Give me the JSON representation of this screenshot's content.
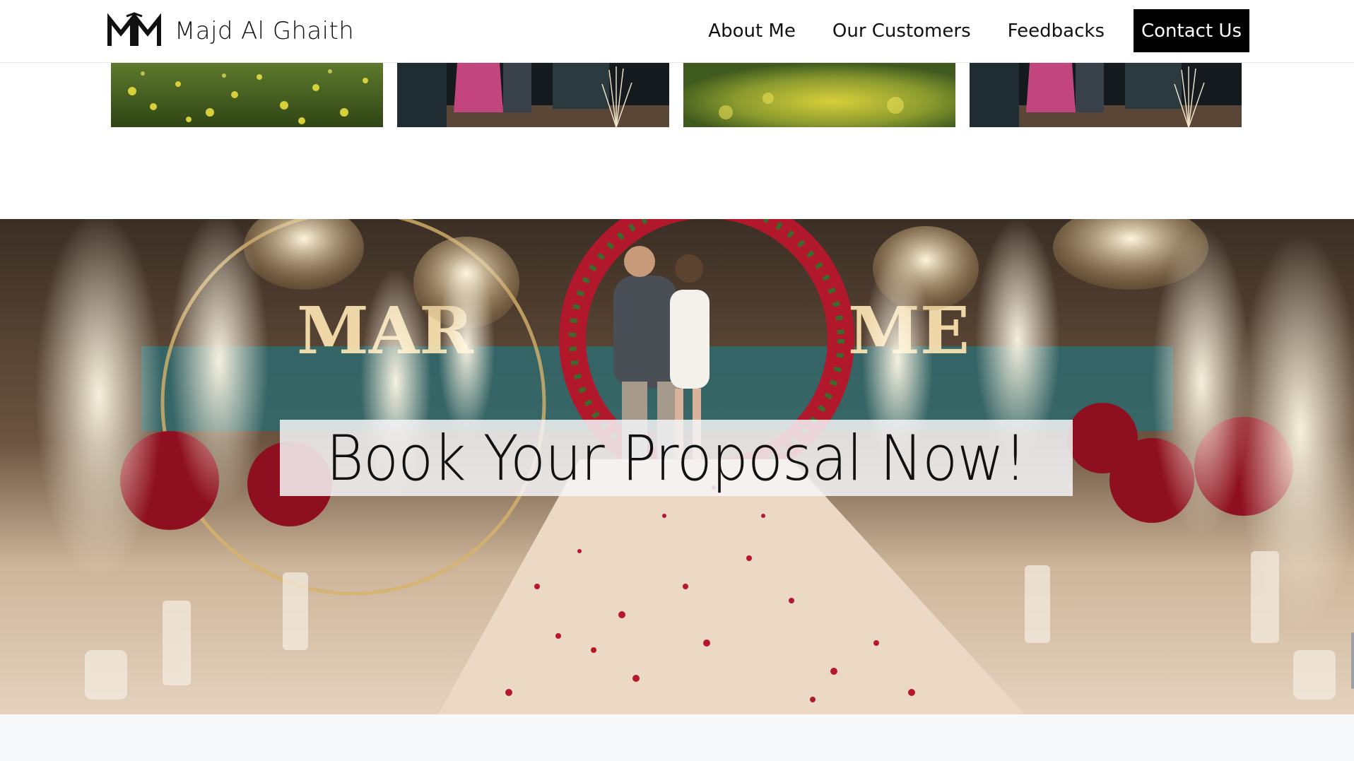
{
  "header": {
    "brand_name": "Majd Al Ghaith",
    "logo_icon": "mg-monogram-logo",
    "nav": {
      "about": "About Me",
      "customers": "Our Customers",
      "feedbacks": "Feedbacks",
      "contact": "Contact Us"
    }
  },
  "gallery": {
    "items": [
      {
        "alt": "yellow flowers garden"
      },
      {
        "alt": "pink dress proposal with sparklers"
      },
      {
        "alt": "blurred yellow garden"
      },
      {
        "alt": "pink dress proposal with sparklers"
      }
    ]
  },
  "hero": {
    "title": "Book Your Proposal Now!"
  },
  "colors": {
    "cta_background": "#000000",
    "cta_text": "#ffffff",
    "header_background": "#ffffff",
    "title_box": "#f5f5f7"
  }
}
